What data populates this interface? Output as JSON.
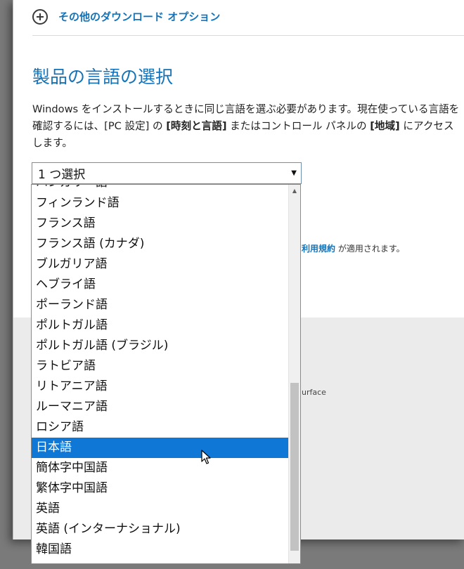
{
  "more_options": {
    "label": "その他のダウンロード オプション"
  },
  "language_section": {
    "title": "製品の言語の選択",
    "desc_1": "Windows をインストールするときに同じ言語を選ぶ必要があります。現在使っている言語を確認するには、[PC 設定] の ",
    "desc_bold_1": "[時刻と言語]",
    "desc_2": " またはコントロール パネルの ",
    "desc_bold_2": "[地域]",
    "desc_3": " にアクセスします。"
  },
  "select": {
    "value": "1 つ選択"
  },
  "background": {
    "terms_link": "利用規約",
    "terms_suffix": " が適用されます。",
    "surface_text": "urface"
  },
  "dropdown": {
    "options": [
      "ハンガリー語",
      "フィンランド語",
      "フランス語",
      "フランス語 (カナダ)",
      "ブルガリア語",
      "ヘブライ語",
      "ポーランド語",
      "ポルトガル語",
      "ポルトガル語 (ブラジル)",
      "ラトビア語",
      "リトアニア語",
      "ルーマニア語",
      "ロシア語",
      "日本語",
      "簡体字中国語",
      "繁体字中国語",
      "英語",
      "英語 (インターナショナル)",
      "韓国語"
    ],
    "highlighted": "日本語"
  },
  "colors": {
    "accent": "#1473b8",
    "highlight": "#0f78d7"
  }
}
